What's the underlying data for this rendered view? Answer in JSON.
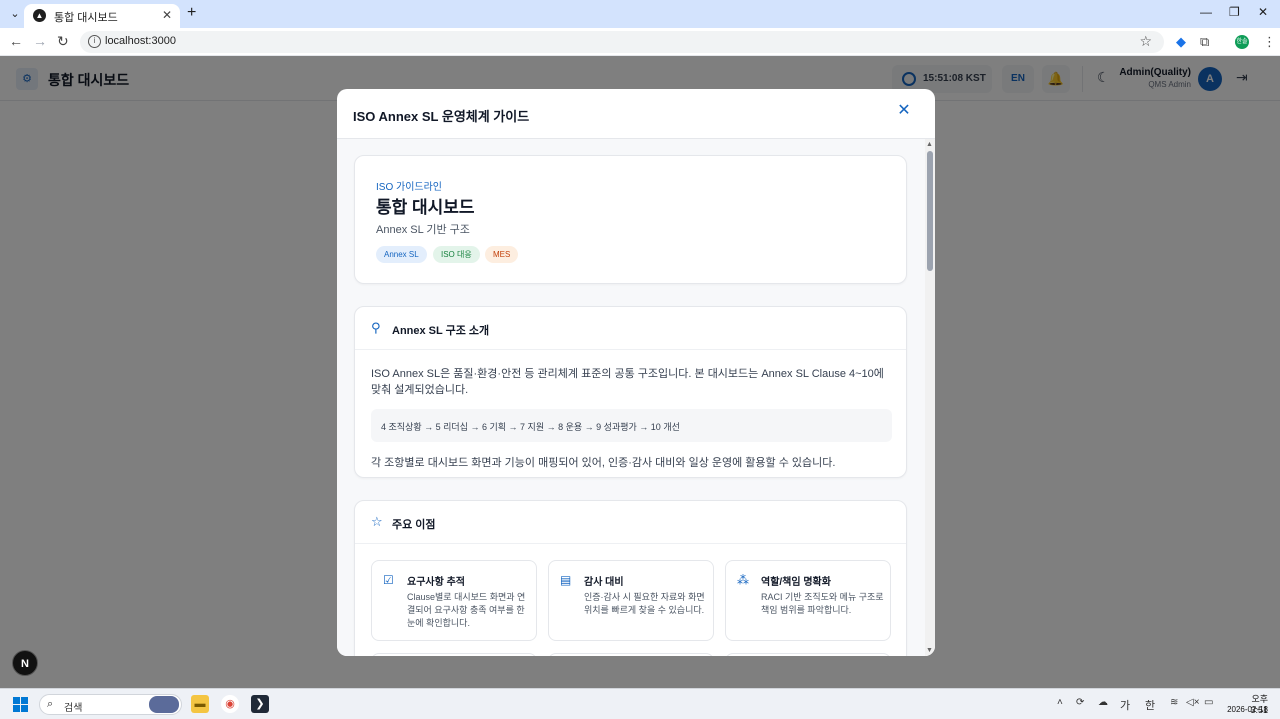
{
  "browser": {
    "tab_title": "통합 대시보드",
    "url": "localhost:3000",
    "profile_label": "한솔"
  },
  "header": {
    "app_title": "통합 대시보드",
    "clock": "15:51:08 KST",
    "lang": "EN",
    "user_name": "Admin(Quality)",
    "user_role": "QMS Admin",
    "avatar": "A"
  },
  "modal": {
    "title": "ISO Annex SL 운영체계 가이드",
    "hero": {
      "eyebrow": "ISO 가이드라인",
      "title": "통합 대시보드",
      "subtitle": "Annex SL 기반 구조",
      "chips": [
        "Annex SL",
        "ISO 대응",
        "MES"
      ]
    },
    "intro": {
      "heading": "Annex SL 구조 소개",
      "p1": "ISO Annex SL은 품질·환경·안전 등 관리체계 표준의 공통 구조입니다. 본 대시보드는 Annex SL Clause 4~10에 맞춰 설계되었습니다.",
      "flow": "4 조직상황 → 5 리더십 → 6 기획 → 7 지원 → 8 운용 → 9 성과평가 → 10 개선",
      "p2": "각 조항별로 대시보드 화면과 기능이 매핑되어 있어, 인증·감사 대비와 일상 운영에 활용할 수 있습니다."
    },
    "benefits": {
      "heading": "주요 이점",
      "items": [
        {
          "title": "요구사항 추적",
          "desc": "Clause별로 대시보드 화면과 연결되어 요구사항 충족 여부를 한눈에 확인합니다."
        },
        {
          "title": "감사 대비",
          "desc": "인증·감사 시 필요한 자료와 화면 위치를 빠르게 찾을 수 있습니다."
        },
        {
          "title": "역할/책임 명확화",
          "desc": "RACI 기반 조직도와 메뉴 구조로 책임 범위를 파악합니다."
        }
      ]
    }
  },
  "taskbar": {
    "search_placeholder": "검색",
    "time": "오후 3:51",
    "date": "2026-02-18",
    "ime_1": "가",
    "ime_2": "한"
  },
  "colors": {
    "accent": "#1565c0",
    "overlay": "#808080"
  }
}
